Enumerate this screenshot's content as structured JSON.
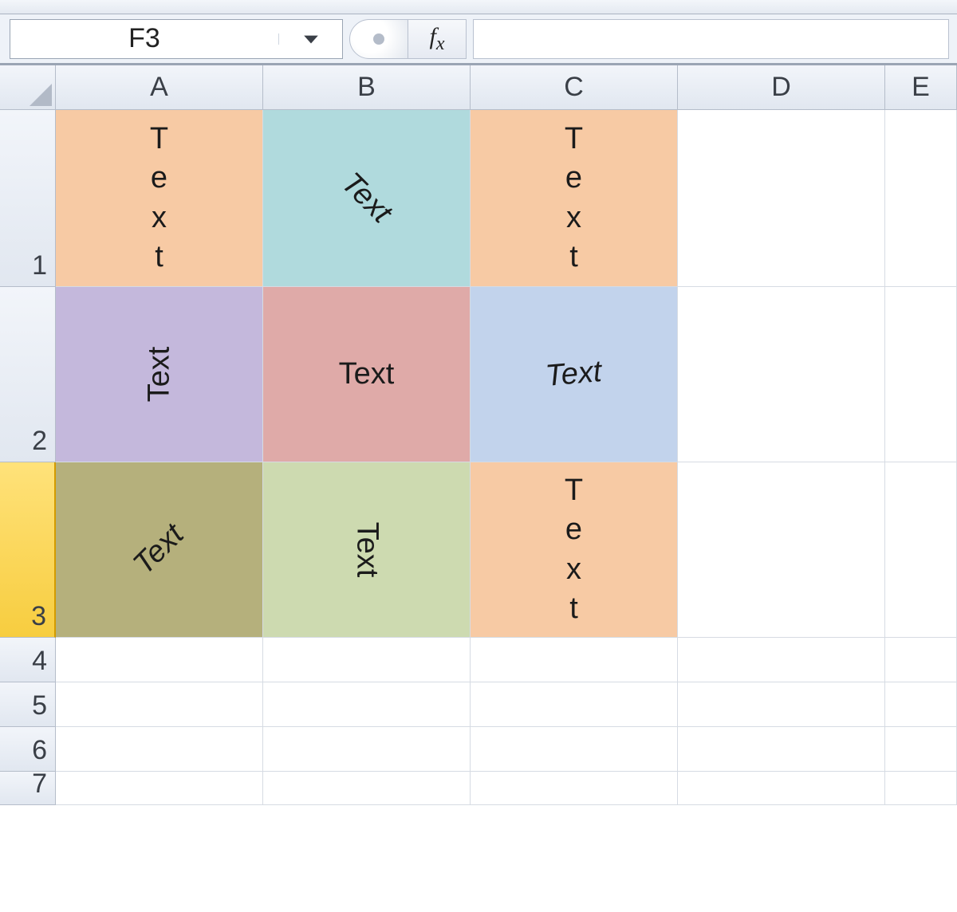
{
  "name_box": {
    "value": "F3"
  },
  "fx_label": "ƒx",
  "formula_value": "",
  "columns": [
    "A",
    "B",
    "C",
    "D",
    "E"
  ],
  "rows_visible": [
    "1",
    "2",
    "3",
    "4",
    "5",
    "6",
    "7"
  ],
  "selected_row": "3",
  "cells": {
    "A1": {
      "value": "Text",
      "orient": "stacked",
      "bg": "peach"
    },
    "B1": {
      "value": "Text",
      "orient": "rot45",
      "bg": "teal"
    },
    "C1": {
      "value": "Text",
      "orient": "stacked",
      "bg": "peach"
    },
    "A2": {
      "value": "Text",
      "orient": "rot90",
      "bg": "lav"
    },
    "B2": {
      "value": "Text",
      "orient": "horiz",
      "bg": "rose"
    },
    "C2": {
      "value": "Text",
      "orient": "tilt5",
      "bg": "ltblue"
    },
    "A3": {
      "value": "Text",
      "orient": "rotm45",
      "bg": "olive"
    },
    "B3": {
      "value": "Text",
      "orient": "rotm90",
      "bg": "sage"
    },
    "C3": {
      "value": "Text",
      "orient": "stacked",
      "bg": "peach"
    }
  }
}
